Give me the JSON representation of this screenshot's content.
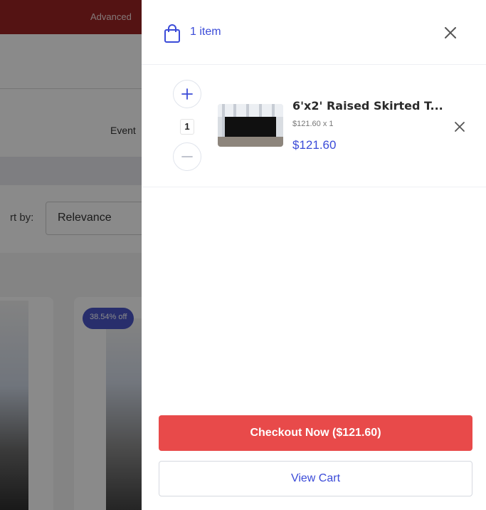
{
  "background": {
    "topbar_text": "Advanced",
    "event_text": "Event",
    "sort_label": "rt by:",
    "sort_value": "Relevance",
    "discount_badge": "38.54% off"
  },
  "cart": {
    "item_count_label": "1 item",
    "items": [
      {
        "name": "6'x2' Raised Skirted T...",
        "unit_price_line": "$121.60 x 1",
        "line_total": "$121.60",
        "quantity": "1"
      }
    ],
    "checkout_label": "Checkout Now ($121.60)",
    "view_cart_label": "View Cart"
  },
  "colors": {
    "accent": "#3b4bd8",
    "checkout": "#e84a4a",
    "brand_bar": "#9c2424",
    "badge": "#4a56c8"
  },
  "icons": {
    "bag": "shopping-bag-icon",
    "close": "close-icon",
    "plus": "plus-icon",
    "minus": "minus-icon",
    "remove": "remove-icon"
  }
}
